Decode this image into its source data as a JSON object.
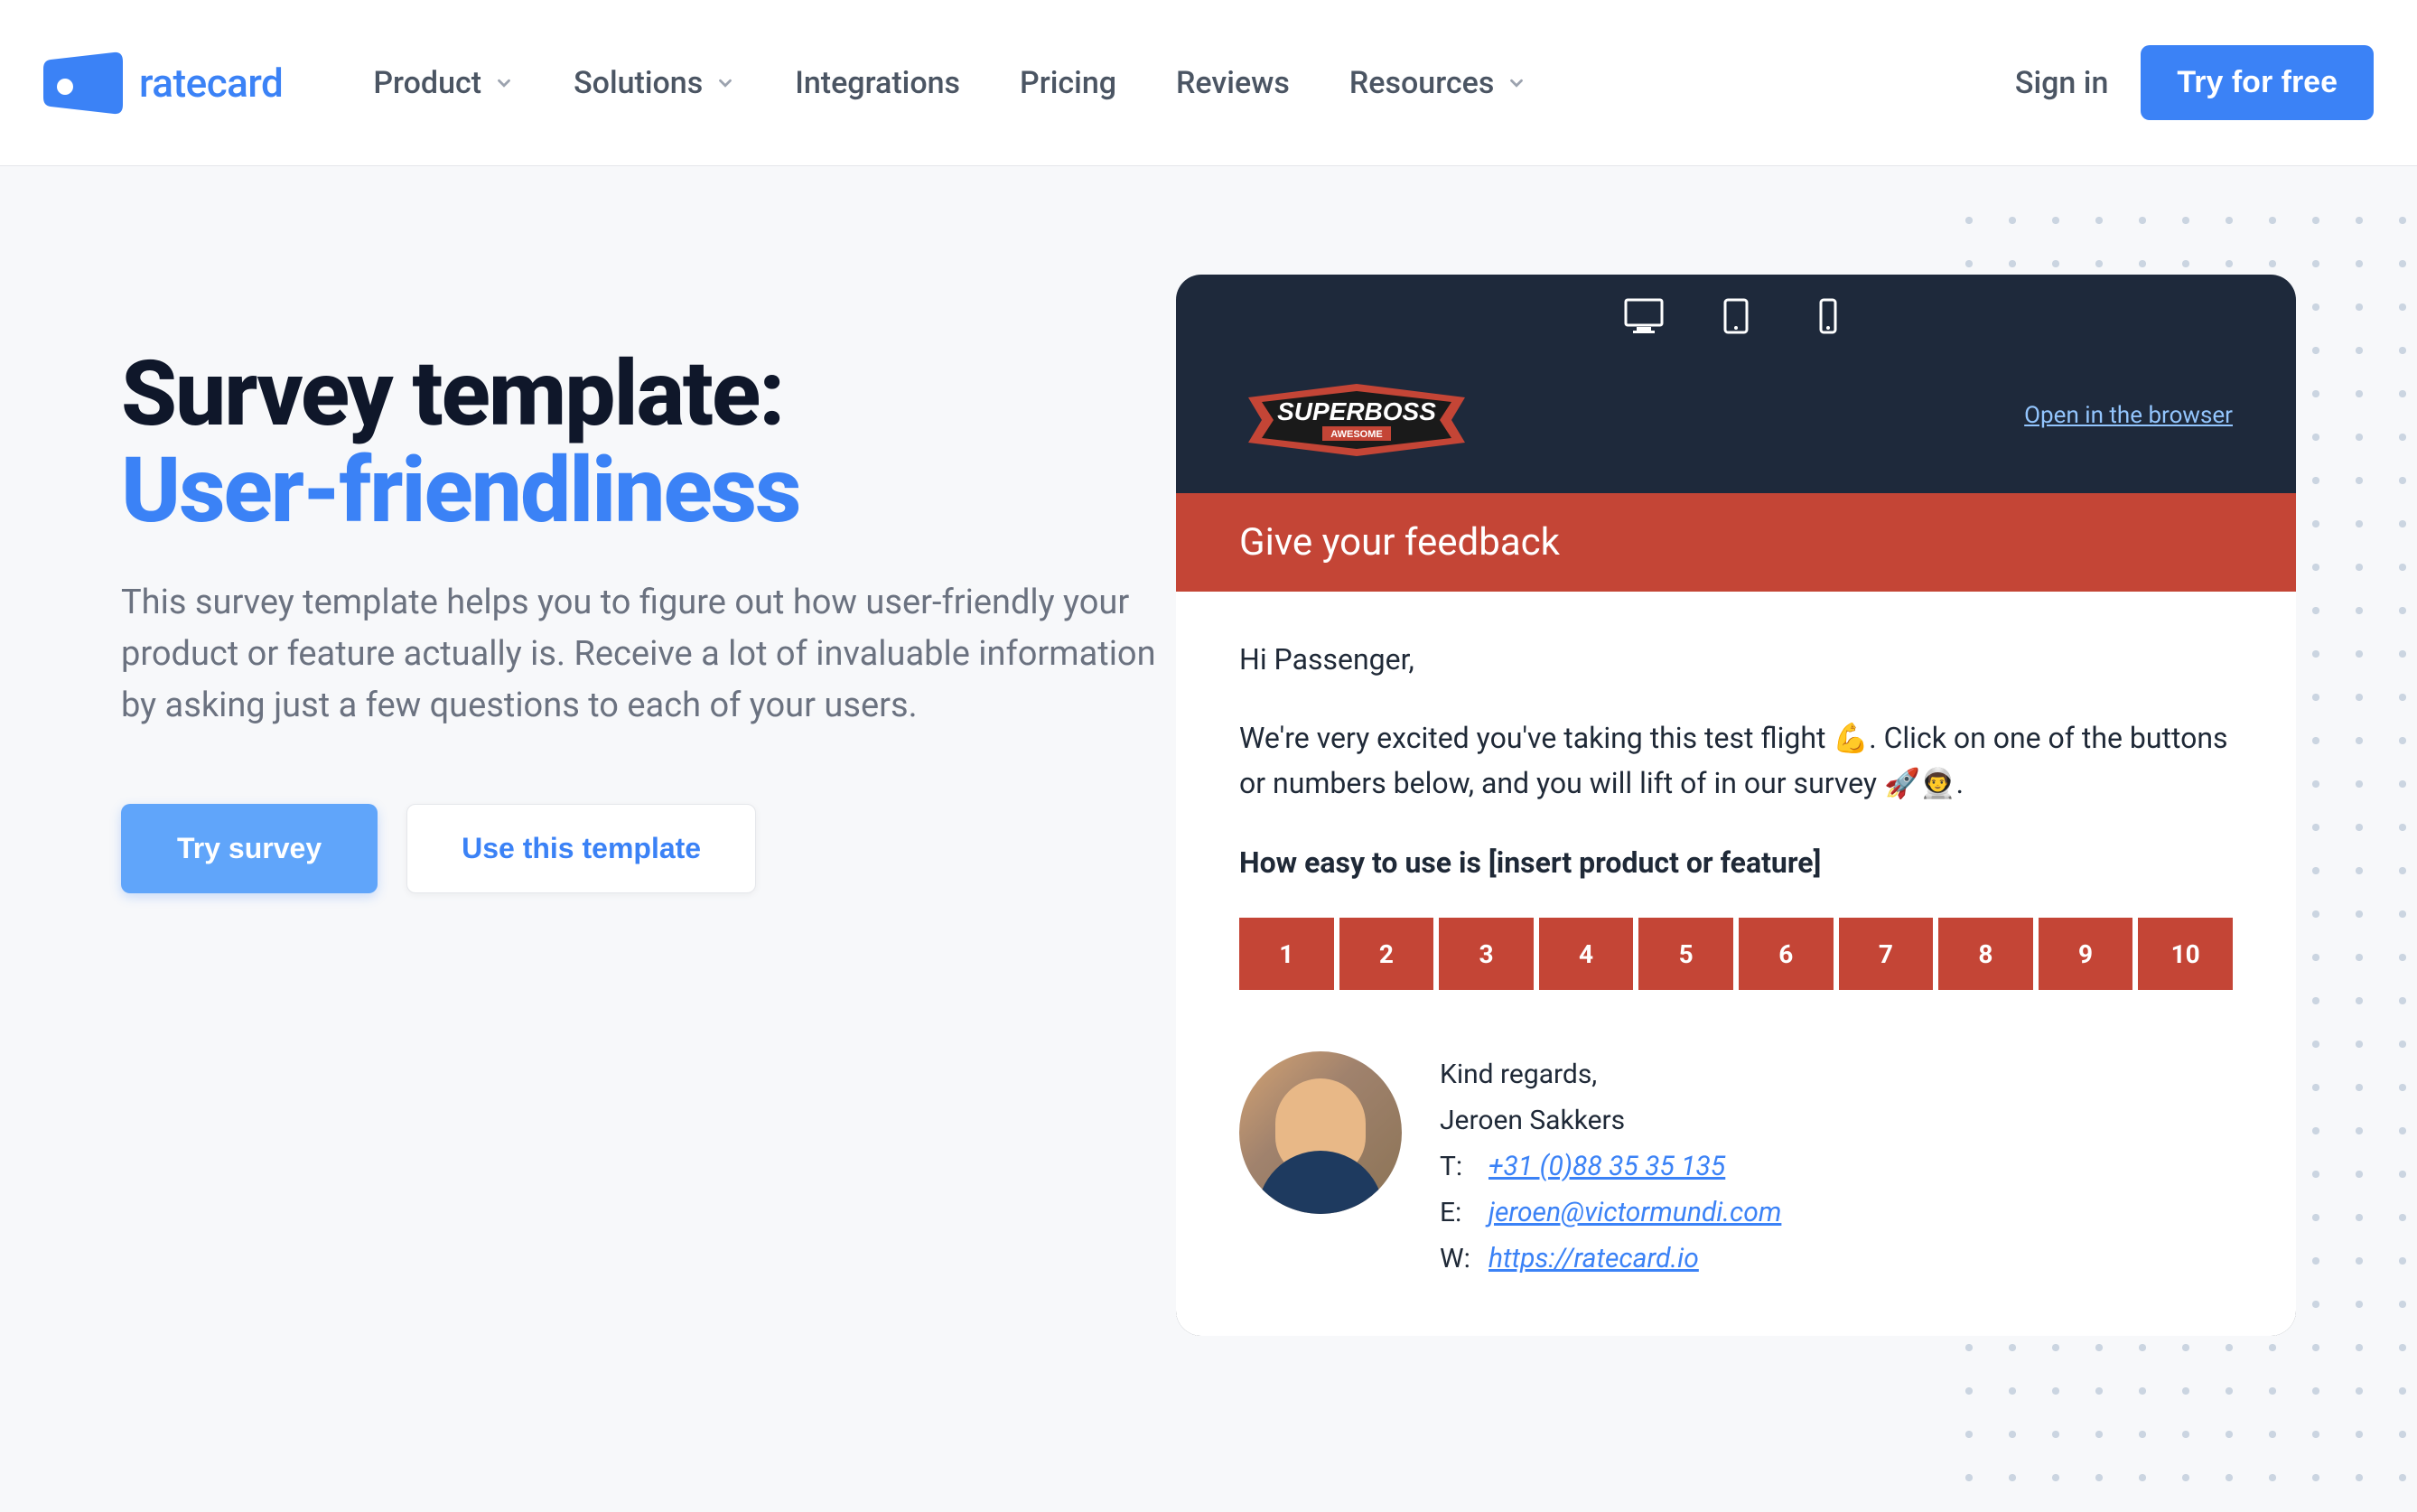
{
  "header": {
    "logo_text": "ratecard",
    "nav": {
      "product": "Product",
      "solutions": "Solutions",
      "integrations": "Integrations",
      "pricing": "Pricing",
      "reviews": "Reviews",
      "resources": "Resources"
    },
    "signin": "Sign in",
    "try_free": "Try for free"
  },
  "hero": {
    "title_line1": "Survey template:",
    "title_line2": "User-friendliness",
    "description": "This survey template helps you to figure out how user-friendly your product or feature actually is. Receive a lot of invaluable information by asking just a few questions to each of your users.",
    "btn_try": "Try survey",
    "btn_use": "Use this template"
  },
  "preview": {
    "brand": "SUPERBOSS",
    "brand_sub": "AWESOME",
    "open_browser": "Open in the browser",
    "feedback_title": "Give your feedback",
    "greeting": "Hi Passenger,",
    "intro": "We're very excited you've taking this test flight 💪. Click on one of the buttons or numbers below, and you will lift of in our survey 🚀👨‍🚀.",
    "question": "How easy to use is [insert product or feature]",
    "scale": [
      "1",
      "2",
      "3",
      "4",
      "5",
      "6",
      "7",
      "8",
      "9",
      "10"
    ],
    "signature": {
      "regards": "Kind regards,",
      "name": "Jeroen Sakkers",
      "phone_label": "T:",
      "phone": "+31 (0)88 35 35 135",
      "email_label": "E:",
      "email": "jeroen@victormundi.com",
      "web_label": "W:",
      "web": "https://ratecard.io"
    }
  }
}
